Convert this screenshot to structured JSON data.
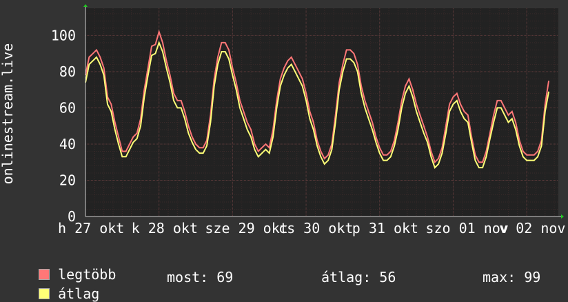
{
  "chart_data": {
    "type": "line",
    "ylabel": "onlinestream.live",
    "ylim": [
      0,
      115
    ],
    "yticks": [
      0,
      20,
      40,
      60,
      80,
      100
    ],
    "xlim": [
      0,
      6.43
    ],
    "x_tick_labels": [
      {
        "x": 0.0,
        "label": "h 27 okt"
      },
      {
        "x": 1.0,
        "label": "k 28 okt"
      },
      {
        "x": 2.0,
        "label": "sze 29 okt"
      },
      {
        "x": 3.0,
        "label": "cs 30 okt"
      },
      {
        "x": 4.0,
        "label": "p 31 okt"
      },
      {
        "x": 5.0,
        "label": "szo 01 nov"
      },
      {
        "x": 6.0,
        "label": "v 02 nov"
      }
    ],
    "grid": true,
    "colors": {
      "background": "#333333",
      "plot": "#222222",
      "grid": "#5a3a3a",
      "max_series": "#ff7777",
      "avg_series": "#ffff77",
      "text": "#ffffff"
    },
    "series": [
      {
        "name": "legtöbb",
        "color": "#ff7777",
        "points": [
          [
            0.0,
            78
          ],
          [
            0.05,
            88
          ],
          [
            0.1,
            90
          ],
          [
            0.15,
            92
          ],
          [
            0.2,
            88
          ],
          [
            0.25,
            82
          ],
          [
            0.3,
            66
          ],
          [
            0.35,
            62
          ],
          [
            0.4,
            52
          ],
          [
            0.45,
            44
          ],
          [
            0.5,
            36
          ],
          [
            0.55,
            36
          ],
          [
            0.6,
            40
          ],
          [
            0.65,
            44
          ],
          [
            0.7,
            46
          ],
          [
            0.75,
            54
          ],
          [
            0.8,
            70
          ],
          [
            0.85,
            82
          ],
          [
            0.9,
            94
          ],
          [
            0.95,
            95
          ],
          [
            1.0,
            102
          ],
          [
            1.05,
            96
          ],
          [
            1.1,
            86
          ],
          [
            1.15,
            78
          ],
          [
            1.2,
            68
          ],
          [
            1.25,
            64
          ],
          [
            1.3,
            64
          ],
          [
            1.35,
            58
          ],
          [
            1.4,
            50
          ],
          [
            1.45,
            44
          ],
          [
            1.5,
            40
          ],
          [
            1.55,
            38
          ],
          [
            1.6,
            38
          ],
          [
            1.65,
            42
          ],
          [
            1.7,
            56
          ],
          [
            1.75,
            76
          ],
          [
            1.8,
            88
          ],
          [
            1.85,
            96
          ],
          [
            1.9,
            96
          ],
          [
            1.95,
            92
          ],
          [
            2.0,
            82
          ],
          [
            2.05,
            74
          ],
          [
            2.1,
            64
          ],
          [
            2.15,
            58
          ],
          [
            2.2,
            52
          ],
          [
            2.25,
            48
          ],
          [
            2.3,
            40
          ],
          [
            2.35,
            36
          ],
          [
            2.4,
            38
          ],
          [
            2.45,
            40
          ],
          [
            2.5,
            38
          ],
          [
            2.55,
            48
          ],
          [
            2.6,
            64
          ],
          [
            2.65,
            76
          ],
          [
            2.7,
            82
          ],
          [
            2.75,
            86
          ],
          [
            2.8,
            88
          ],
          [
            2.85,
            84
          ],
          [
            2.9,
            80
          ],
          [
            2.95,
            76
          ],
          [
            3.0,
            68
          ],
          [
            3.05,
            58
          ],
          [
            3.1,
            52
          ],
          [
            3.15,
            42
          ],
          [
            3.2,
            36
          ],
          [
            3.25,
            32
          ],
          [
            3.3,
            34
          ],
          [
            3.35,
            40
          ],
          [
            3.4,
            56
          ],
          [
            3.45,
            74
          ],
          [
            3.5,
            84
          ],
          [
            3.55,
            92
          ],
          [
            3.6,
            92
          ],
          [
            3.65,
            90
          ],
          [
            3.7,
            84
          ],
          [
            3.75,
            72
          ],
          [
            3.8,
            64
          ],
          [
            3.85,
            58
          ],
          [
            3.9,
            52
          ],
          [
            3.95,
            44
          ],
          [
            4.0,
            38
          ],
          [
            4.05,
            34
          ],
          [
            4.1,
            34
          ],
          [
            4.15,
            36
          ],
          [
            4.2,
            42
          ],
          [
            4.25,
            52
          ],
          [
            4.3,
            64
          ],
          [
            4.35,
            72
          ],
          [
            4.4,
            76
          ],
          [
            4.45,
            70
          ],
          [
            4.5,
            62
          ],
          [
            4.55,
            56
          ],
          [
            4.6,
            50
          ],
          [
            4.65,
            44
          ],
          [
            4.7,
            36
          ],
          [
            4.75,
            30
          ],
          [
            4.8,
            32
          ],
          [
            4.85,
            38
          ],
          [
            4.9,
            50
          ],
          [
            4.95,
            62
          ],
          [
            5.0,
            66
          ],
          [
            5.05,
            68
          ],
          [
            5.1,
            62
          ],
          [
            5.15,
            58
          ],
          [
            5.2,
            56
          ],
          [
            5.25,
            44
          ],
          [
            5.3,
            34
          ],
          [
            5.35,
            30
          ],
          [
            5.4,
            30
          ],
          [
            5.45,
            36
          ],
          [
            5.5,
            46
          ],
          [
            5.55,
            56
          ],
          [
            5.6,
            64
          ],
          [
            5.65,
            64
          ],
          [
            5.7,
            60
          ],
          [
            5.75,
            56
          ],
          [
            5.8,
            58
          ],
          [
            5.85,
            52
          ],
          [
            5.9,
            42
          ],
          [
            5.95,
            36
          ],
          [
            6.0,
            34
          ],
          [
            6.05,
            34
          ],
          [
            6.1,
            34
          ],
          [
            6.15,
            36
          ],
          [
            6.2,
            42
          ],
          [
            6.25,
            62
          ],
          [
            6.3,
            75
          ]
        ]
      },
      {
        "name": "átlag",
        "color": "#ffff77",
        "points": [
          [
            0.0,
            74
          ],
          [
            0.05,
            84
          ],
          [
            0.1,
            86
          ],
          [
            0.15,
            88
          ],
          [
            0.2,
            84
          ],
          [
            0.25,
            78
          ],
          [
            0.3,
            62
          ],
          [
            0.35,
            58
          ],
          [
            0.4,
            48
          ],
          [
            0.45,
            40
          ],
          [
            0.5,
            33
          ],
          [
            0.55,
            33
          ],
          [
            0.6,
            37
          ],
          [
            0.65,
            41
          ],
          [
            0.7,
            43
          ],
          [
            0.75,
            50
          ],
          [
            0.8,
            66
          ],
          [
            0.85,
            78
          ],
          [
            0.9,
            89
          ],
          [
            0.95,
            90
          ],
          [
            1.0,
            96
          ],
          [
            1.05,
            91
          ],
          [
            1.1,
            82
          ],
          [
            1.15,
            74
          ],
          [
            1.2,
            64
          ],
          [
            1.25,
            60
          ],
          [
            1.3,
            60
          ],
          [
            1.35,
            54
          ],
          [
            1.4,
            46
          ],
          [
            1.45,
            41
          ],
          [
            1.5,
            37
          ],
          [
            1.55,
            35
          ],
          [
            1.6,
            35
          ],
          [
            1.65,
            39
          ],
          [
            1.7,
            52
          ],
          [
            1.75,
            72
          ],
          [
            1.8,
            84
          ],
          [
            1.85,
            91
          ],
          [
            1.9,
            91
          ],
          [
            1.95,
            87
          ],
          [
            2.0,
            78
          ],
          [
            2.05,
            70
          ],
          [
            2.1,
            60
          ],
          [
            2.15,
            54
          ],
          [
            2.2,
            48
          ],
          [
            2.25,
            44
          ],
          [
            2.3,
            37
          ],
          [
            2.35,
            33
          ],
          [
            2.4,
            35
          ],
          [
            2.45,
            37
          ],
          [
            2.5,
            35
          ],
          [
            2.55,
            44
          ],
          [
            2.6,
            60
          ],
          [
            2.65,
            72
          ],
          [
            2.7,
            78
          ],
          [
            2.75,
            82
          ],
          [
            2.8,
            84
          ],
          [
            2.85,
            80
          ],
          [
            2.9,
            76
          ],
          [
            2.95,
            72
          ],
          [
            3.0,
            64
          ],
          [
            3.05,
            54
          ],
          [
            3.1,
            48
          ],
          [
            3.15,
            39
          ],
          [
            3.2,
            33
          ],
          [
            3.25,
            29
          ],
          [
            3.3,
            31
          ],
          [
            3.35,
            37
          ],
          [
            3.4,
            52
          ],
          [
            3.45,
            70
          ],
          [
            3.5,
            80
          ],
          [
            3.55,
            87
          ],
          [
            3.6,
            87
          ],
          [
            3.65,
            85
          ],
          [
            3.7,
            80
          ],
          [
            3.75,
            68
          ],
          [
            3.8,
            60
          ],
          [
            3.85,
            54
          ],
          [
            3.9,
            48
          ],
          [
            3.95,
            41
          ],
          [
            4.0,
            35
          ],
          [
            4.05,
            31
          ],
          [
            4.1,
            31
          ],
          [
            4.15,
            33
          ],
          [
            4.2,
            39
          ],
          [
            4.25,
            48
          ],
          [
            4.3,
            60
          ],
          [
            4.35,
            68
          ],
          [
            4.4,
            72
          ],
          [
            4.45,
            66
          ],
          [
            4.5,
            58
          ],
          [
            4.55,
            52
          ],
          [
            4.6,
            46
          ],
          [
            4.65,
            41
          ],
          [
            4.7,
            33
          ],
          [
            4.75,
            27
          ],
          [
            4.8,
            29
          ],
          [
            4.85,
            35
          ],
          [
            4.9,
            46
          ],
          [
            4.95,
            58
          ],
          [
            5.0,
            62
          ],
          [
            5.05,
            64
          ],
          [
            5.1,
            58
          ],
          [
            5.15,
            54
          ],
          [
            5.2,
            52
          ],
          [
            5.25,
            41
          ],
          [
            5.3,
            31
          ],
          [
            5.35,
            27
          ],
          [
            5.4,
            27
          ],
          [
            5.45,
            33
          ],
          [
            5.5,
            43
          ],
          [
            5.55,
            52
          ],
          [
            5.6,
            60
          ],
          [
            5.65,
            60
          ],
          [
            5.7,
            56
          ],
          [
            5.75,
            52
          ],
          [
            5.8,
            54
          ],
          [
            5.85,
            48
          ],
          [
            5.9,
            39
          ],
          [
            5.95,
            33
          ],
          [
            6.0,
            31
          ],
          [
            6.05,
            31
          ],
          [
            6.1,
            31
          ],
          [
            6.15,
            33
          ],
          [
            6.2,
            39
          ],
          [
            6.25,
            58
          ],
          [
            6.3,
            69
          ]
        ]
      }
    ]
  },
  "legend": {
    "items": [
      {
        "label": "legtöbb",
        "color": "#ff7777"
      },
      {
        "label": "átlag",
        "color": "#ffff77"
      }
    ],
    "stats": {
      "most": "most: 69",
      "atlag": "átlag: 56",
      "max": "max: 99"
    }
  }
}
